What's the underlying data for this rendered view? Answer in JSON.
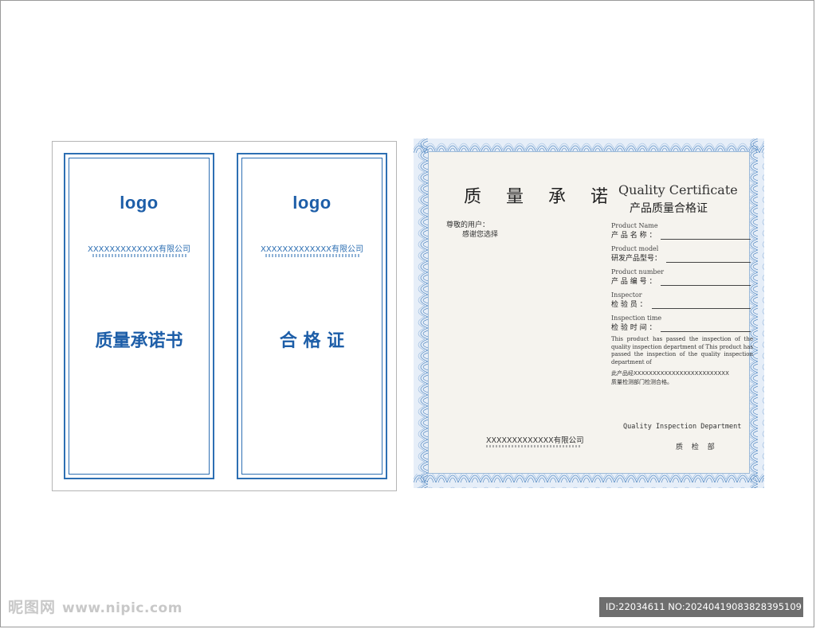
{
  "left_sheet": {
    "covers": [
      {
        "logo": "logo",
        "company": "XXXXXXXXXXXXX有限公司",
        "title": "质量承诺书"
      },
      {
        "logo": "logo",
        "company": "XXXXXXXXXXXXX有限公司",
        "title": "合 格 证"
      }
    ]
  },
  "certificate": {
    "promise_title": "质 量 承 诺",
    "greeting_line1": "尊敬的用户：",
    "greeting_line2": "感谢您选择",
    "en_title": "Quality Certificate",
    "cn_title": "产品质量合格证",
    "fields": [
      {
        "en": "Product Name",
        "cn": "产 品 名 称 ："
      },
      {
        "en": "Product model",
        "cn": "研发产品型号："
      },
      {
        "en": "Product number",
        "cn": "产 品 编 号 ："
      },
      {
        "en": "Inspector",
        "cn": "检  验  员  ："
      },
      {
        "en": "Inspection time",
        "cn": "检 验 时 间 ："
      }
    ],
    "statement_en": "This product has passed the inspection of the quality inspection department of This product has passed the inspection of the quality inspection department of",
    "statement_cn_line1": "此产品经XXXXXXXXXXXXXXXXXXXXXXXXX",
    "statement_cn_line2": "质量检测部门检测合格。",
    "department_en": "Quality Inspection Department",
    "department_cn": "质 检 部",
    "company": "XXXXXXXXXXXXX有限公司"
  },
  "watermark": {
    "site_name": "昵图网",
    "site_url": "www.nipic.com",
    "id_text": "ID:22034611 NO:20240419083828395109"
  },
  "colors": {
    "cover_blue": "#1d5ea8",
    "border_blue": "#2d6fb3",
    "guilloche_blue": "#5b8fc6",
    "id_bar": "#6e6e6e"
  }
}
